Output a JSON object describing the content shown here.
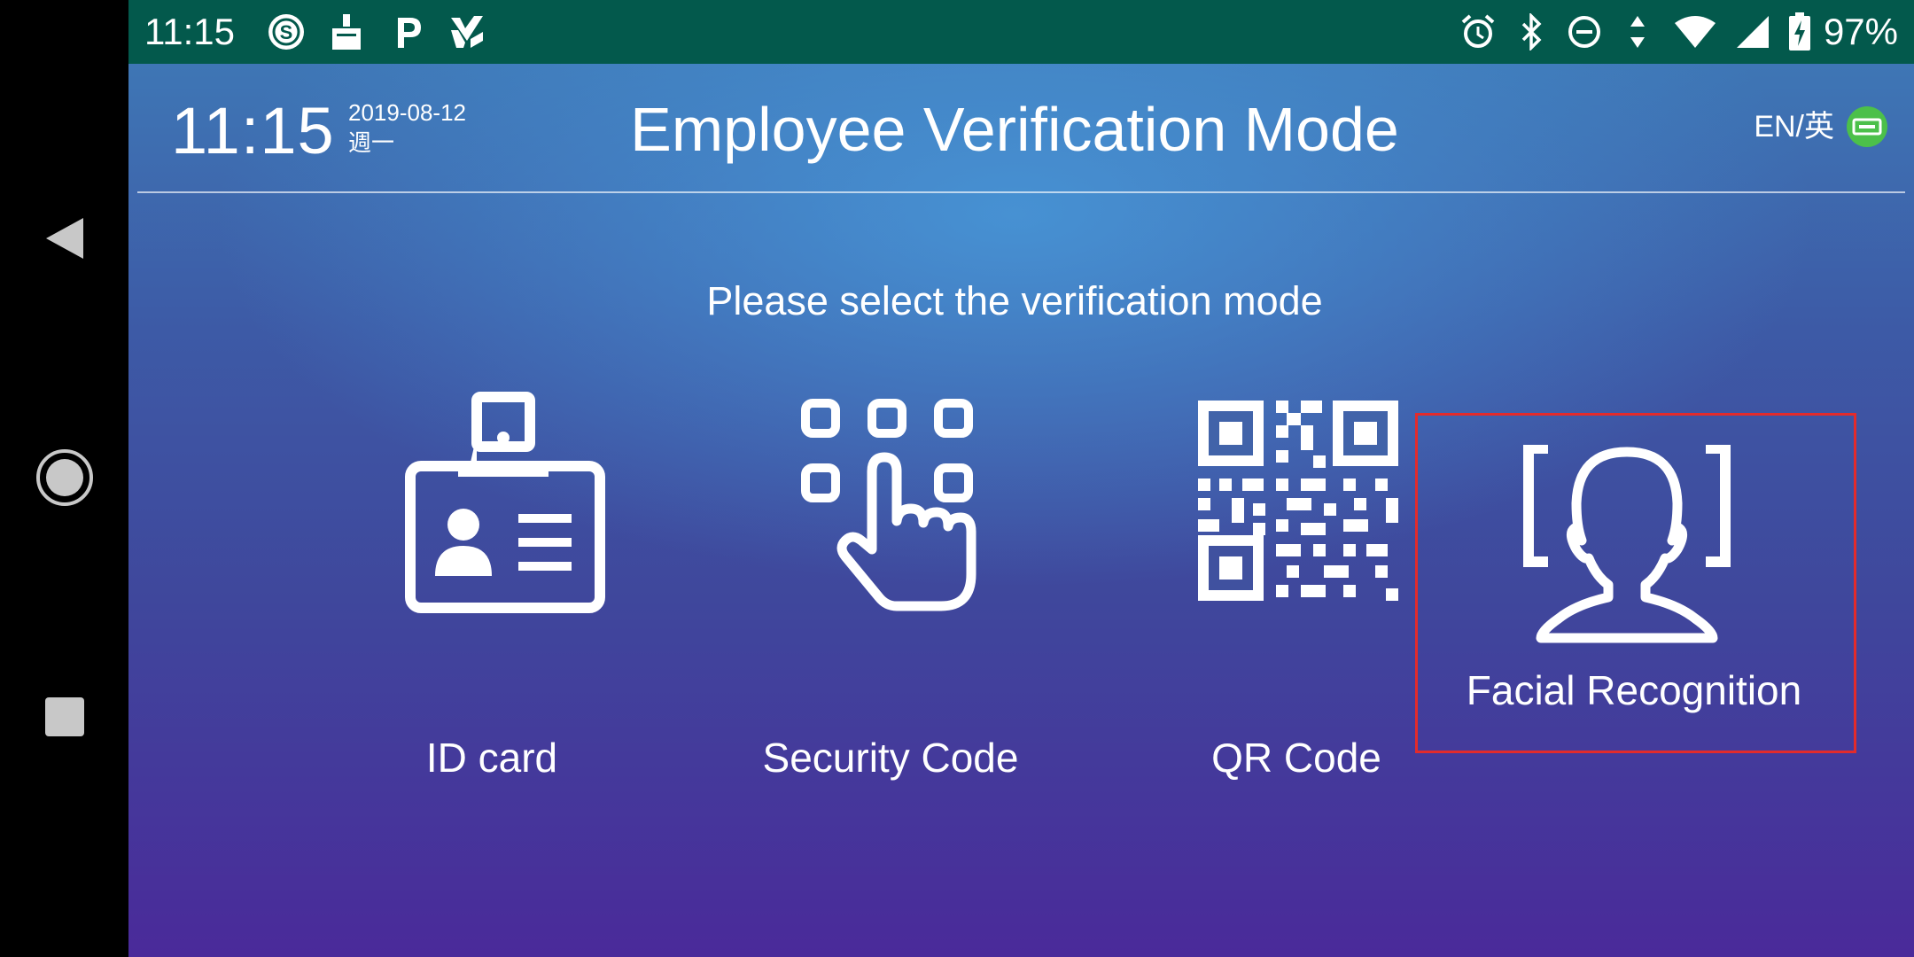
{
  "status_bar": {
    "time": "11:15",
    "left_icons": [
      "sync-icon",
      "cleaner-icon",
      "parking-icon",
      "task-check-icon"
    ],
    "right_icons": [
      "alarm-icon",
      "bluetooth-icon",
      "do-not-disturb-icon",
      "data-arrows-icon",
      "wifi-icon",
      "cell-signal-icon",
      "battery-charging-icon"
    ],
    "battery_percent": "97%"
  },
  "header": {
    "clock": "11:15",
    "date": "2019-08-12",
    "weekday": "週一",
    "title": "Employee Verification Mode",
    "language_label": "EN/英",
    "language_icon": "network-badge-icon"
  },
  "prompt": "Please select the verification mode",
  "modes": [
    {
      "label": "ID card",
      "icon": "id-card-icon"
    },
    {
      "label": "Security Code",
      "icon": "keypad-touch-icon"
    },
    {
      "label": "QR Code",
      "icon": "qr-code-icon"
    },
    {
      "label": "Facial Recognition",
      "icon": "face-scan-icon",
      "highlighted": true
    }
  ],
  "colors": {
    "status_bar": "#03594c",
    "highlight": "#e32b2b",
    "language_badge": "#4cc04a"
  }
}
